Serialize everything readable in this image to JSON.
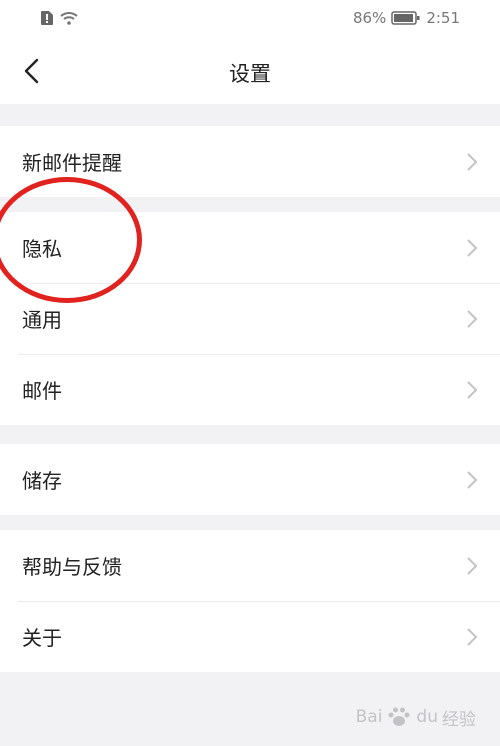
{
  "status_bar": {
    "battery_percent": "86%",
    "time": "2:51"
  },
  "header": {
    "title": "设置"
  },
  "groups": [
    {
      "items": [
        {
          "label": "新邮件提醒"
        }
      ]
    },
    {
      "items": [
        {
          "label": "隐私"
        },
        {
          "label": "通用"
        },
        {
          "label": "邮件"
        }
      ]
    },
    {
      "items": [
        {
          "label": "储存"
        }
      ]
    },
    {
      "items": [
        {
          "label": "帮助与反馈"
        },
        {
          "label": "关于"
        }
      ]
    }
  ],
  "annotation": {
    "color": "#e1221f"
  },
  "watermark": {
    "text": "Bai du 经验",
    "brand": "Bai",
    "brand2": "du",
    "suffix": "经验"
  },
  "colors": {
    "background": "#f2f2f4",
    "surface": "#ffffff",
    "text": "#222222",
    "chevron": "#c4c4c4"
  }
}
